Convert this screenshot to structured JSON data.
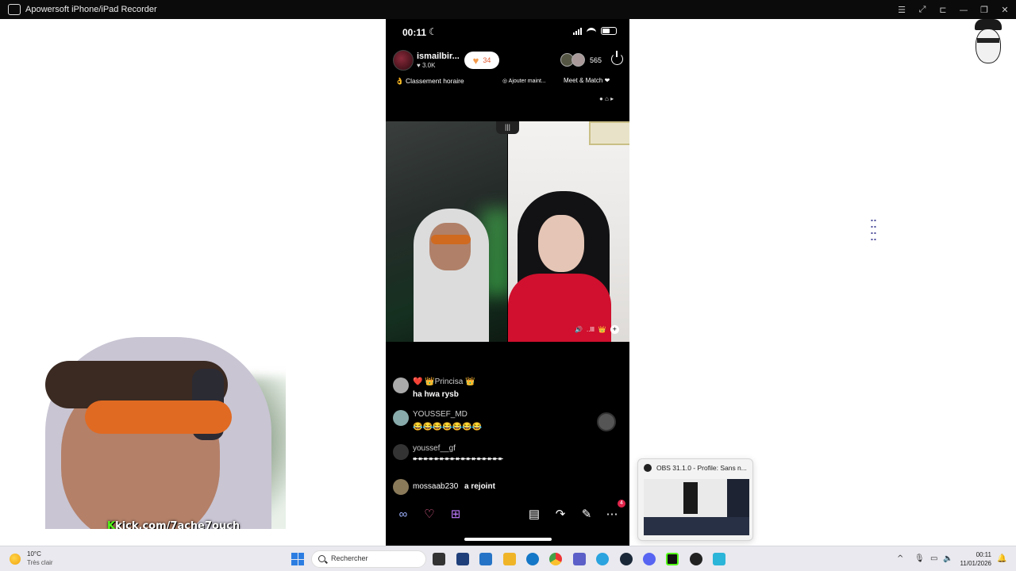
{
  "window": {
    "title": "Apowersoft iPhone/iPad Recorder",
    "controls": [
      "list-icon",
      "expand-icon",
      "pin-icon",
      "minimize-icon",
      "restore-icon",
      "close-icon"
    ]
  },
  "phone": {
    "status": {
      "time": "00:11",
      "moon": "☾"
    },
    "host": {
      "name": "ismailbir...",
      "likes": "♥ 3.0K",
      "gift_count": "34"
    },
    "viewers": {
      "count": "565"
    },
    "ranking": {
      "label": "Classement horaire",
      "add_label": "Ajouter maint...",
      "meet_label": "Meet & Match"
    },
    "chat": [
      {
        "name": "👑Princisa 👑",
        "prefix": "❤️",
        "text": "ha hwa rysb"
      },
      {
        "name": "YOUSSEF_MD",
        "text": "😂😂😂😂😂😂😂"
      },
      {
        "name": "youssef__gf",
        "text": "↞↞↞↞↞↞↞↞↞↞↞↞↞↞↞↞↞"
      },
      {
        "name": "mossaab230",
        "text": "a rejoint"
      }
    ],
    "toolbar_badge": "4",
    "colors": {
      "accent": "#e0244a",
      "gift": "#f39a4b"
    }
  },
  "webcam": {
    "kick_icon": "K",
    "link": "kick.com/7ache7ouch"
  },
  "obs_popup": {
    "title": "OBS 31.1.0 - Profile: Sans n..."
  },
  "taskbar": {
    "weather": {
      "temp": "10°C",
      "condition": "Très clair"
    },
    "search_placeholder": "Rechercher",
    "clock": {
      "time": "00:11",
      "date": "11/01/2026"
    }
  }
}
